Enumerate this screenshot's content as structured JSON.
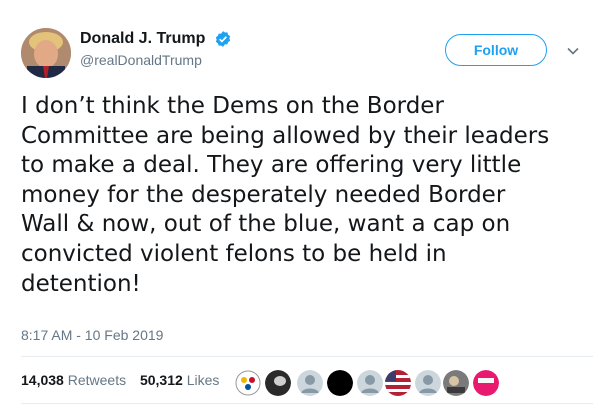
{
  "user": {
    "display_name": "Donald J. Trump",
    "handle": "@realDonaldTrump",
    "verified": true
  },
  "follow_label": "Follow",
  "tweet": {
    "text": "I don’t think the Dems on the Border\nCommittee are being allowed by their leaders\nto make a deal. They are offering very little\nmoney for the desperately needed Border\nWall & now, out of the blue, want a cap on\nconvicted violent felons to be held in\ndetention!",
    "timestamp": "8:17 AM - 10 Feb 2019"
  },
  "stats": {
    "retweets_count": "14,038",
    "retweets_label": "Retweets",
    "likes_count": "50,312",
    "likes_label": "Likes"
  },
  "colors": {
    "accent": "#1da1f2",
    "secondary_text": "#657786",
    "divider": "#e6ecf0"
  },
  "liker_avatars": [
    {
      "icon": "steelers-logo"
    },
    {
      "icon": "dark-avatar"
    },
    {
      "icon": "default-egg"
    },
    {
      "icon": "black-avatar"
    },
    {
      "icon": "default-egg"
    },
    {
      "icon": "flag-avatar"
    },
    {
      "icon": "default-egg"
    },
    {
      "icon": "photo-avatar"
    },
    {
      "icon": "pink-hat-avatar"
    }
  ]
}
